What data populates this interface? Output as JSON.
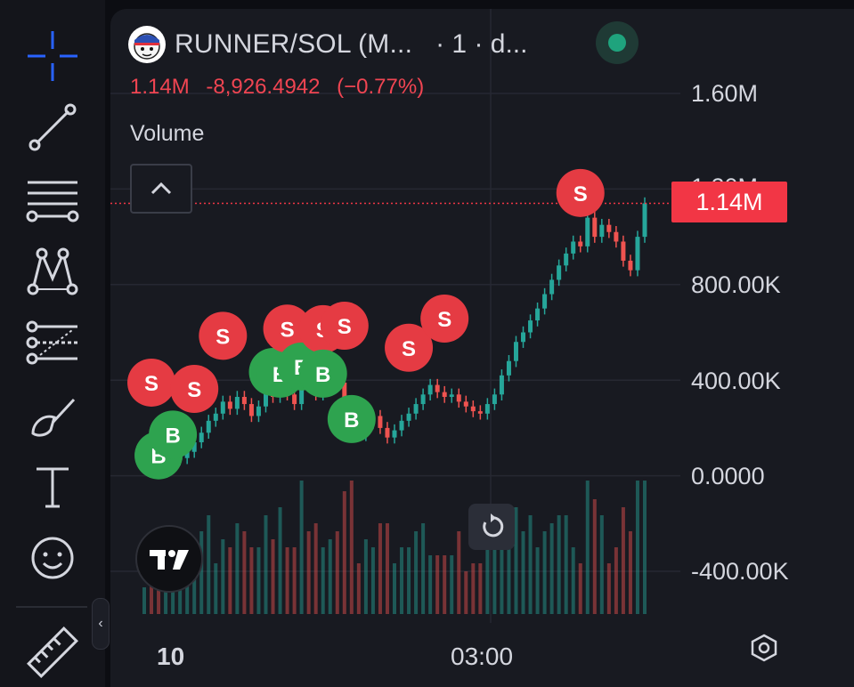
{
  "symbol": {
    "title": "RUNNER/SOL (M...",
    "interval": "· 1 · d..."
  },
  "price": {
    "last": "1.14M",
    "change": "-8,926.4942",
    "change_pct": "(−0.77%)"
  },
  "volume_label": "Volume",
  "price_tag": "1.14M",
  "y_axis": [
    "1.60M",
    "1.20M",
    "800.00K",
    "400.00K",
    "0.0000",
    "-400.00K"
  ],
  "x_axis": [
    "10",
    "03:00"
  ],
  "markers": {
    "buy": "B",
    "sell": "S"
  },
  "colors": {
    "up": "#26a69a",
    "down": "#ef5350",
    "sell_marker": "#e53b43",
    "buy_marker": "#2ea34f",
    "accent": "#2962ff"
  },
  "toolbar": [
    "crosshair-icon",
    "trend-line-icon",
    "fib-icon",
    "pattern-icon",
    "prediction-icon",
    "brush-icon",
    "text-icon",
    "emoji-icon",
    "ruler-icon"
  ],
  "chart_data": {
    "type": "candlestick",
    "series": [
      {
        "name": "",
        "close": [
          70000,
          62000,
          48000,
          52000,
          68000,
          74000,
          100000,
          140000,
          180000,
          230000,
          260000,
          310000,
          280000,
          330000,
          300000,
          250000,
          290000,
          360000,
          330000,
          390000,
          340000,
          300000,
          420000,
          380000,
          340000,
          390000,
          440000,
          390000,
          300000,
          200000,
          170000,
          220000,
          250000,
          200000,
          160000,
          190000,
          230000,
          260000,
          300000,
          340000,
          380000,
          350000,
          330000,
          340000,
          310000,
          290000,
          270000,
          260000,
          300000,
          340000,
          420000,
          480000,
          560000,
          600000,
          650000,
          700000,
          760000,
          820000,
          880000,
          930000,
          980000,
          960000,
          1080000,
          1000000,
          1050000,
          1020000,
          980000,
          900000,
          860000,
          1000000,
          1140000
        ]
      }
    ],
    "markers": [
      {
        "side": "B",
        "x": 2
      },
      {
        "side": "B",
        "x": 4
      },
      {
        "side": "S",
        "x": 1
      },
      {
        "side": "S",
        "x": 7
      },
      {
        "side": "S",
        "x": 11
      },
      {
        "side": "B",
        "x": 18
      },
      {
        "side": "B",
        "x": 19
      },
      {
        "side": "S",
        "x": 20
      },
      {
        "side": "B",
        "x": 22
      },
      {
        "side": "S",
        "x": 25
      },
      {
        "side": "B",
        "x": 25
      },
      {
        "side": "S",
        "x": 28
      },
      {
        "side": "B",
        "x": 29
      },
      {
        "side": "S",
        "x": 37
      },
      {
        "side": "S",
        "x": 42
      },
      {
        "side": "S",
        "x": 61
      }
    ],
    "ylim": [
      -400000,
      1600000
    ]
  }
}
